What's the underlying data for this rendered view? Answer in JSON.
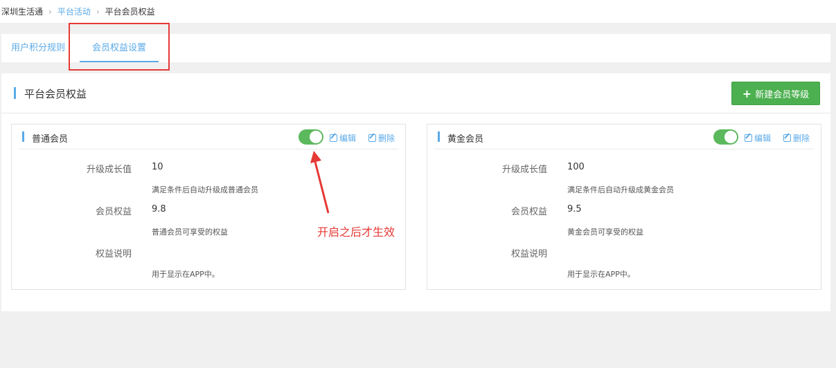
{
  "breadcrumb": {
    "items": [
      "深圳生活通",
      "平台活动",
      "平台会员权益"
    ]
  },
  "tabs": {
    "items": [
      {
        "label": "用户积分规则"
      },
      {
        "label": "会员权益设置"
      }
    ],
    "active_index": 1
  },
  "section": {
    "title": "平台会员权益",
    "new_button_label": "新建会员等级"
  },
  "actions": {
    "edit": "编辑",
    "delete": "删除"
  },
  "cards": [
    {
      "title": "普通会员",
      "enabled": true,
      "growth_label": "升级成长值",
      "growth_value": "10",
      "growth_desc": "满足条件后自动升级成普通会员",
      "rights_label": "会员权益",
      "rights_value": "9.8",
      "rights_desc": "普通会员可享受的权益",
      "explain_label": "权益说明",
      "explain_desc": "用于显示在APP中。"
    },
    {
      "title": "黄金会员",
      "enabled": true,
      "growth_label": "升级成长值",
      "growth_value": "100",
      "growth_desc": "满足条件后自动升级成黄金会员",
      "rights_label": "会员权益",
      "rights_value": "9.5",
      "rights_desc": "黄金会员可享受的权益",
      "explain_label": "权益说明",
      "explain_desc": "用于显示在APP中。"
    }
  ],
  "annotation": {
    "text": "开启之后才生效"
  },
  "colors": {
    "accent": "#5aaae8",
    "success": "#4cb050",
    "annotation": "#e53935"
  }
}
